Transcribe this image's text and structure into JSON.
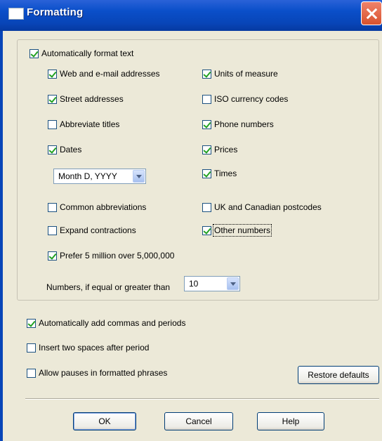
{
  "window": {
    "title": "Formatting"
  },
  "main": {
    "auto_format": {
      "label": "Automatically format text",
      "checked": true
    },
    "left": [
      {
        "label": "Web and e-mail addresses",
        "checked": true
      },
      {
        "label": "Street addresses",
        "checked": true
      },
      {
        "label": "Abbreviate titles",
        "checked": false
      },
      {
        "label": "Dates",
        "checked": true
      },
      {
        "label": "Common abbreviations",
        "checked": false
      },
      {
        "label": "Expand contractions",
        "checked": false
      },
      {
        "label": "Prefer 5 million over 5,000,000",
        "checked": true
      }
    ],
    "right": [
      {
        "label": "Units of measure",
        "checked": true
      },
      {
        "label": "ISO currency codes",
        "checked": false
      },
      {
        "label": "Phone numbers",
        "checked": true
      },
      {
        "label": "Prices",
        "checked": true
      },
      {
        "label": "Times",
        "checked": true
      },
      {
        "label": "UK and Canadian postcodes",
        "checked": false
      },
      {
        "label": "Other numbers",
        "checked": true
      }
    ],
    "date_format": {
      "value": "Month D, YYYY"
    },
    "numbers_threshold": {
      "label": "Numbers, if equal or greater than",
      "value": "10"
    }
  },
  "bottom": {
    "add_commas": {
      "label": "Automatically add commas and periods",
      "checked": true
    },
    "two_spaces": {
      "label": "Insert two spaces after period",
      "checked": false
    },
    "allow_pauses": {
      "label": "Allow pauses in formatted phrases",
      "checked": false
    },
    "restore_defaults": "Restore defaults"
  },
  "buttons": {
    "ok": "OK",
    "cancel": "Cancel",
    "help": "Help"
  }
}
